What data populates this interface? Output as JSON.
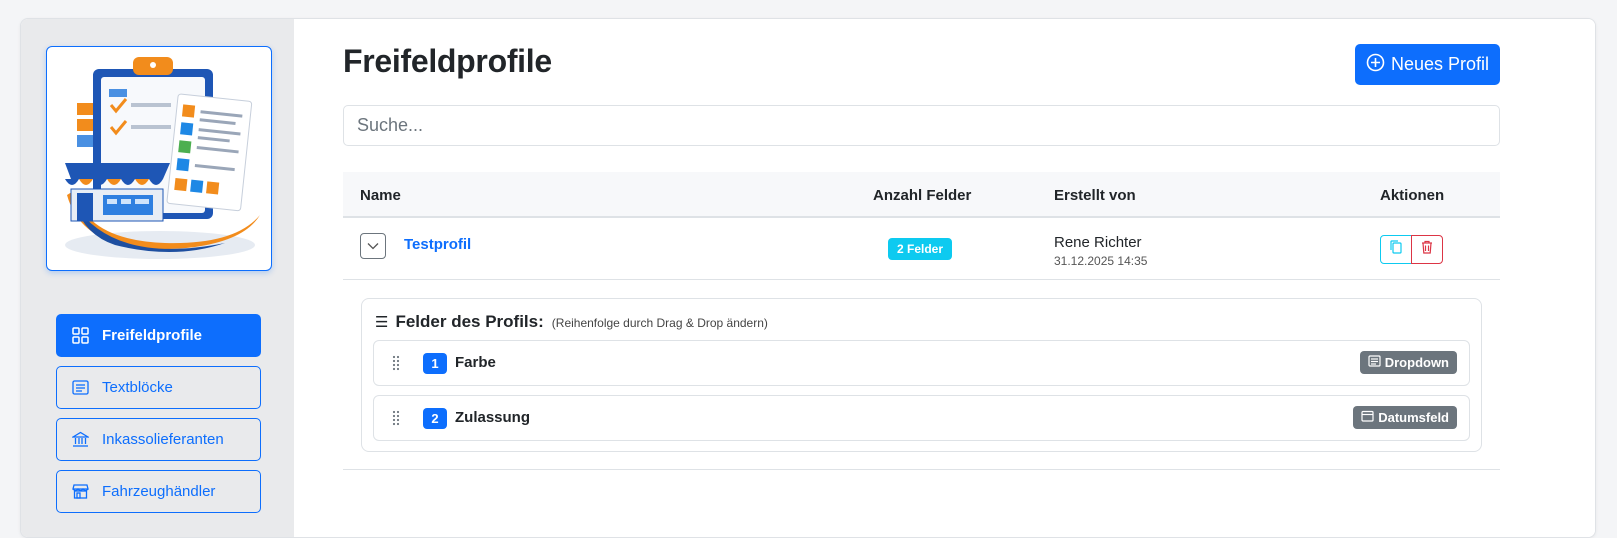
{
  "sidebar": {
    "items": [
      {
        "label": "Freifeldprofile",
        "icon": "grid-icon",
        "active": true
      },
      {
        "label": "Textblöcke",
        "icon": "text-block-icon",
        "active": false
      },
      {
        "label": "Inkassolieferanten",
        "icon": "bank-icon",
        "active": false
      },
      {
        "label": "Fahrzeughändler",
        "icon": "store-icon",
        "active": false
      }
    ]
  },
  "header": {
    "title": "Freifeldprofile",
    "new_button_label": "Neues Profil"
  },
  "search": {
    "placeholder": "Suche...",
    "value": ""
  },
  "table": {
    "columns": {
      "name": "Name",
      "count": "Anzahl Felder",
      "creator": "Erstellt von",
      "actions": "Aktionen"
    },
    "rows": [
      {
        "name": "Testprofil",
        "field_count": "2 Felder",
        "creator": "Rene Richter",
        "created_at": "31.12.2025 14:35"
      }
    ]
  },
  "fields_panel": {
    "title": "Felder des Profils:",
    "hint": "(Reihenfolge durch Drag & Drop ändern)",
    "fields": [
      {
        "index": "1",
        "name": "Farbe",
        "type": "Dropdown",
        "type_icon": "dropdown-icon"
      },
      {
        "index": "2",
        "name": "Zulassung",
        "type": "Datumsfeld",
        "type_icon": "calendar-icon"
      }
    ]
  },
  "colors": {
    "primary": "#0d6efd",
    "info": "#0dcaf0",
    "danger": "#dc3545",
    "secondary": "#6c757d"
  }
}
